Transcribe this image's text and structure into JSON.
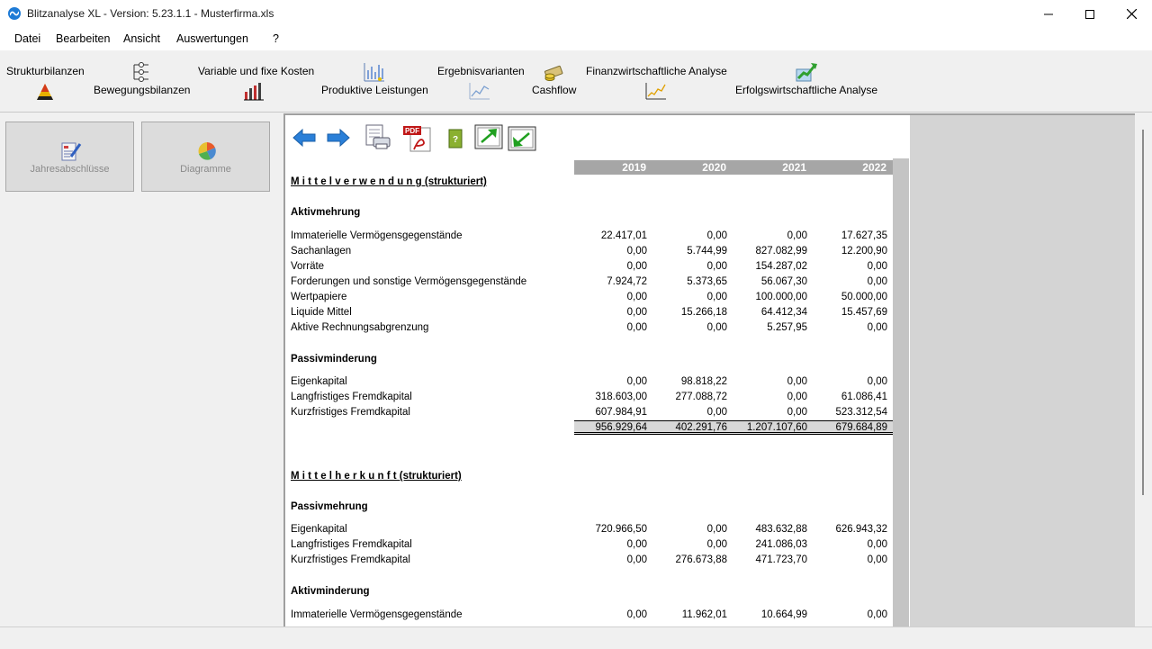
{
  "window": {
    "title": "Blitzanalyse XL - Version: 5.23.1.1 - Musterfirma.xls"
  },
  "menu": [
    "Datei",
    "Bearbeiten",
    "Ansicht",
    "Auswertungen",
    "?"
  ],
  "toolbar": {
    "strukturbilanzen": "Strukturbilanzen",
    "bewegungsbilanzen": "Bewegungsbilanzen",
    "variable_kosten": "Variable und fixe Kosten",
    "produktive_leistungen": "Produktive Leistungen",
    "ergebnisvarianten": "Ergebnisvarianten",
    "cashflow": "Cashflow",
    "finanz_analyse": "Finanzwirtschaftliche Analyse",
    "erfolgs_analyse": "Erfolgswirtschaftliche Analyse"
  },
  "nav": {
    "jahresabschluesse": "Jahresabschlüsse",
    "diagramme": "Diagramme"
  },
  "years": [
    "2019",
    "2020",
    "2021",
    "2022"
  ],
  "mittelverwendung": {
    "title": "M i t t e l v e r w e n d u n g  (strukturiert)",
    "aktivmehrung": {
      "title": "Aktivmehrung",
      "rows": [
        {
          "label": "Immaterielle Vermögensgegenstände",
          "values": [
            "22.417,01",
            "0,00",
            "0,00",
            "17.627,35"
          ]
        },
        {
          "label": "Sachanlagen",
          "values": [
            "0,00",
            "5.744,99",
            "827.082,99",
            "12.200,90"
          ]
        },
        {
          "label": "Vorräte",
          "values": [
            "0,00",
            "0,00",
            "154.287,02",
            "0,00"
          ]
        },
        {
          "label": "Forderungen und sonstige Vermögensgegenstände",
          "values": [
            "7.924,72",
            "5.373,65",
            "56.067,30",
            "0,00"
          ]
        },
        {
          "label": "Wertpapiere",
          "values": [
            "0,00",
            "0,00",
            "100.000,00",
            "50.000,00"
          ]
        },
        {
          "label": "Liquide Mittel",
          "values": [
            "0,00",
            "15.266,18",
            "64.412,34",
            "15.457,69"
          ]
        },
        {
          "label": "Aktive Rechnungsabgrenzung",
          "values": [
            "0,00",
            "0,00",
            "5.257,95",
            "0,00"
          ]
        }
      ]
    },
    "passivminderung": {
      "title": "Passivminderung",
      "rows": [
        {
          "label": "Eigenkapital",
          "values": [
            "0,00",
            "98.818,22",
            "0,00",
            "0,00"
          ]
        },
        {
          "label": "Langfristiges Fremdkapital",
          "values": [
            "318.603,00",
            "277.088,72",
            "0,00",
            "61.086,41"
          ]
        },
        {
          "label": "Kurzfristiges Fremdkapital",
          "values": [
            "607.984,91",
            "0,00",
            "0,00",
            "523.312,54"
          ]
        }
      ]
    },
    "total": [
      "956.929,64",
      "402.291,76",
      "1.207.107,60",
      "679.684,89"
    ]
  },
  "mittelherkunft": {
    "title": "M i t t e l h e r k u n f t  (strukturiert)",
    "passivmehrung": {
      "title": "Passivmehrung",
      "rows": [
        {
          "label": "Eigenkapital",
          "values": [
            "720.966,50",
            "0,00",
            "483.632,88",
            "626.943,32"
          ]
        },
        {
          "label": "Langfristiges Fremdkapital",
          "values": [
            "0,00",
            "0,00",
            "241.086,03",
            "0,00"
          ]
        },
        {
          "label": "Kurzfristiges Fremdkapital",
          "values": [
            "0,00",
            "276.673,88",
            "471.723,70",
            "0,00"
          ]
        }
      ]
    },
    "aktivminderung": {
      "title": "Aktivminderung",
      "rows": [
        {
          "label": "Immaterielle Vermögensgegenstände",
          "values": [
            "0,00",
            "11.962,01",
            "10.664,99",
            "0,00"
          ]
        }
      ]
    }
  },
  "colors": {
    "header_gray": "#a6a6a6",
    "total_gray": "#d8d8d8",
    "accent_blue": "#1e7bd6"
  },
  "icons": [
    "app-icon",
    "minimize-icon",
    "maximize-icon",
    "close-icon",
    "arrow-left-icon",
    "arrow-right-icon",
    "print-icon",
    "pdf-icon",
    "excel-icon",
    "export-icon",
    "import-icon"
  ]
}
